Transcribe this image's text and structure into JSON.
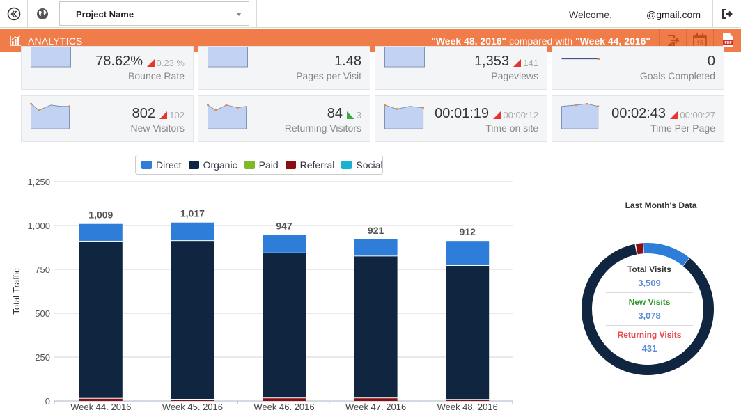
{
  "topbar": {
    "project_name": "Project Name",
    "welcome": "Welcome,",
    "email": "@gmail.com",
    "icons": [
      "collapse-icon",
      "globe-icon",
      "logout-icon"
    ]
  },
  "analytics_bar": {
    "title": "ANALYTICS",
    "week_current": "\"Week 48, 2016\"",
    "compared_with": "compared with",
    "week_previous": "\"Week 44, 2016\"",
    "icons": [
      "export-icon",
      "calendar-icon",
      "pdf-icon"
    ],
    "calendar_day": "15",
    "pdf_text": "PDF"
  },
  "kpis": [
    {
      "label": "Bounce Rate",
      "value": "78.62%",
      "delta": "0.23 %",
      "trend": "down"
    },
    {
      "label": "Pages per Visit",
      "value": "1.48",
      "delta": "",
      "trend": "none"
    },
    {
      "label": "Pageviews",
      "value": "1,353",
      "delta": "141",
      "trend": "down"
    },
    {
      "label": "Goals Completed",
      "value": "0",
      "delta": "",
      "trend": "none"
    },
    {
      "label": "New Visitors",
      "value": "802",
      "delta": "102",
      "trend": "down"
    },
    {
      "label": "Returning Visitors",
      "value": "84",
      "delta": "3",
      "trend": "up"
    },
    {
      "label": "Time on site",
      "value": "00:01:19",
      "delta": "00:00:12",
      "trend": "down"
    },
    {
      "label": "Time Per Page",
      "value": "00:02:43",
      "delta": "00:00:27",
      "trend": "down"
    }
  ],
  "colors": {
    "accent": "#f07c49",
    "direct": "#2e7dd8",
    "organic": "#0f2540",
    "paid": "#7fb927",
    "referral": "#8b0f12",
    "social": "#1ab3cf",
    "spark_fill": "#c2d2f2",
    "spark_point": "#f08a2c",
    "new_visits": "#2e9a2e",
    "returning_visits": "#e8494a"
  },
  "chart_data": {
    "type": "bar",
    "stacked": true,
    "categories": [
      "Week 44, 2016",
      "Week 45, 2016",
      "Week 46, 2016",
      "Week 47, 2016",
      "Week 48, 2016"
    ],
    "series": [
      {
        "name": "Direct",
        "values": [
          100,
          105,
          105,
          97,
          142
        ]
      },
      {
        "name": "Organic",
        "values": [
          896,
          904,
          827,
          809,
          763
        ]
      },
      {
        "name": "Paid",
        "values": [
          0,
          0,
          0,
          0,
          0
        ]
      },
      {
        "name": "Referral",
        "values": [
          13,
          8,
          15,
          15,
          7
        ]
      },
      {
        "name": "Social",
        "values": [
          0,
          0,
          0,
          0,
          0
        ]
      }
    ],
    "totals": [
      "1,009",
      "1,017",
      "947",
      "921",
      "912"
    ],
    "ylabel": "Total Traffic",
    "ylim": [
      0,
      1250
    ],
    "yticks": [
      "0",
      "250",
      "500",
      "750",
      "1,000",
      "1,250"
    ],
    "grid": true,
    "legend": "top"
  },
  "donut": {
    "title": "Last Month's Data",
    "total_visits_label": "Total Visits",
    "total_visits": "3,509",
    "new_visits_label": "New Visits",
    "new_visits": "3,078",
    "returning_visits_label": "Returning Visits",
    "returning_visits": "431",
    "segments": [
      {
        "name": "Direct",
        "value": 0.12
      },
      {
        "name": "Organic",
        "value": 0.86
      },
      {
        "name": "Referral",
        "value": 0.02
      }
    ]
  }
}
